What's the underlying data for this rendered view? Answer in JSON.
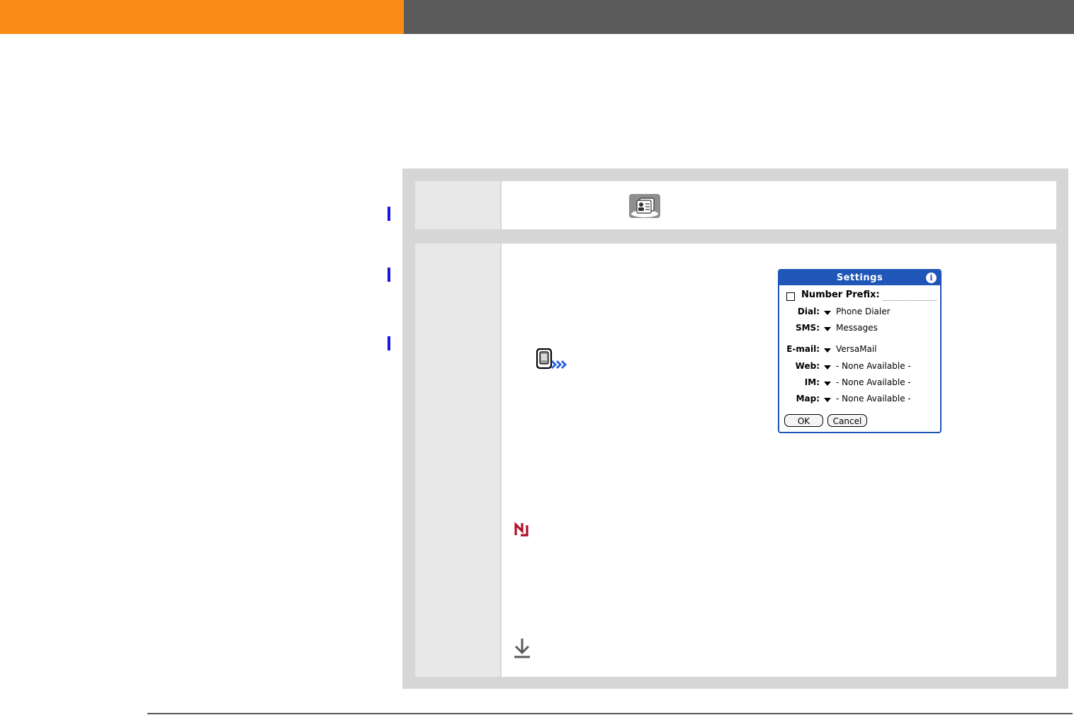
{
  "header": {
    "left_color": "#fb8b17",
    "right_color": "#5b5b5b"
  },
  "margin_markers": {
    "color": "#1a12e6",
    "count": 3
  },
  "procedure": {
    "steps": [
      {
        "icons": [
          "contacts-app-icon"
        ]
      },
      {
        "icons": [
          "prefs-app-icon",
          "tip-icon",
          "done-icon"
        ]
      }
    ]
  },
  "settings_dialog": {
    "title": "Settings",
    "info_glyph": "i",
    "number_prefix_label": "Number Prefix:",
    "number_prefix_checked": false,
    "rows": [
      {
        "label": "Dial:",
        "value": "Phone Dialer"
      },
      {
        "label": "SMS:",
        "value": "Messages"
      },
      {
        "label": "E-mail:",
        "value": "VersaMail"
      },
      {
        "label": "Web:",
        "value": "- None Available -"
      },
      {
        "label": "IM:",
        "value": "- None Available -"
      },
      {
        "label": "Map:",
        "value": "- None Available -"
      }
    ],
    "ok_label": "OK",
    "cancel_label": "Cancel",
    "accent_color": "#1f56b8"
  },
  "colors": {
    "tip_icon": "#b0102a",
    "done_icon": "#5b5b5b",
    "frame": "#d6d6d6",
    "step_number_cell": "#e8e8e8"
  }
}
